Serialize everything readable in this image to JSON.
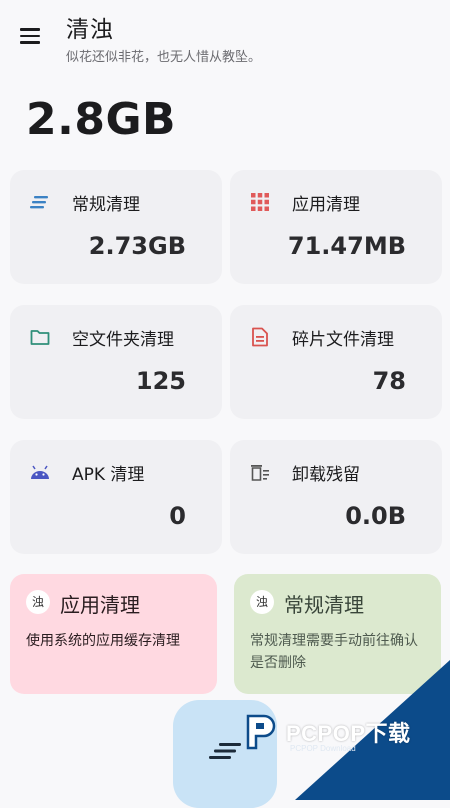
{
  "header": {
    "title": "清浊",
    "subtitle": "似花还似非花，也无人惜从教坠。"
  },
  "total_size": "2.8GB",
  "cards": [
    {
      "label": "常规清理",
      "value": "2.73GB",
      "icon": "lines-icon",
      "color": "#3b82c4"
    },
    {
      "label": "应用清理",
      "value": "71.47MB",
      "icon": "grid-icon",
      "color": "#e05a5a"
    },
    {
      "label": "空文件夹清理",
      "value": "125",
      "icon": "folder-icon",
      "color": "#2f8f7a"
    },
    {
      "label": "碎片文件清理",
      "value": "78",
      "icon": "document-icon",
      "color": "#d9534f"
    },
    {
      "label": "APK 清理",
      "value": "0",
      "icon": "android-icon",
      "color": "#4a56c2"
    },
    {
      "label": "卸载残留",
      "value": "0.0B",
      "icon": "trash-icon",
      "color": "#555555"
    }
  ],
  "info_cards": [
    {
      "badge": "浊",
      "title": "应用清理",
      "description": "使用系统的应用缓存清理",
      "color": "#ffd9e1"
    },
    {
      "badge": "浊",
      "title": "常规清理",
      "description": "常规清理需要手动前往确认是否删除",
      "color": "#dce9cf"
    }
  ],
  "fab": {
    "icon": "sweep-lines-icon",
    "color": "#c9e3f6"
  },
  "watermark": {
    "brand": "PCPOP下载",
    "sub": "PCPOP Download"
  }
}
